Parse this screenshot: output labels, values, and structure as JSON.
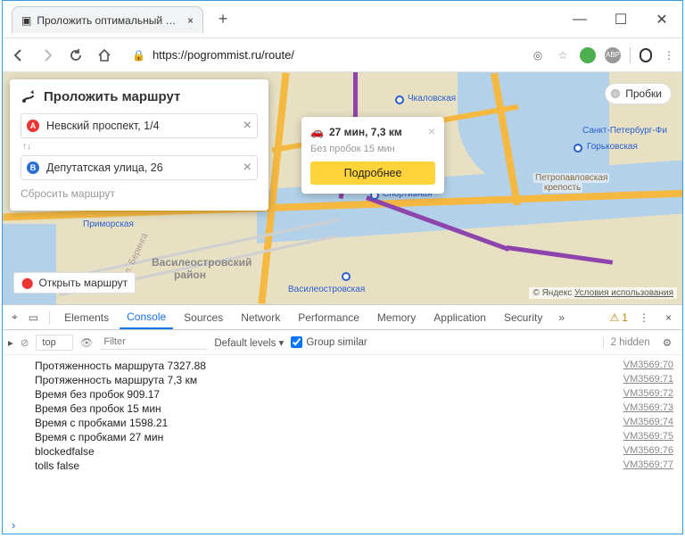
{
  "browser": {
    "tab_title": "Проложить оптимальный марш…",
    "url": "https://pogrommist.ru/route/",
    "url_secure_label": "🔒"
  },
  "route_panel": {
    "title": "Проложить маршрут",
    "from": "Невский проспект, 1/4",
    "to": "Депутатская улица, 26",
    "reset": "Сбросить маршрут"
  },
  "balloon": {
    "summary": "27 мин, 7,3 км",
    "nojam": "Без пробок 15 мин",
    "more": "Подробнее"
  },
  "traffic_label": "Пробки",
  "open_route": "Открыть маршрут",
  "attribution": {
    "prefix": "© Яндекс ",
    "link": "Условия использования"
  },
  "map_labels": {
    "chkalovskaya": "Чкаловская",
    "gorkovskaya": "Горьковская",
    "sportivnaya": "Спортивная",
    "vasileostrovskaya": "Василеостровская",
    "primorskaya": "Приморская",
    "spb_phi": "Санкт-Петербург-Фи",
    "petropavl1": "Петропавловская",
    "petropavl2": "крепость",
    "vasil_rayon1": "Василеостровский",
    "vasil_rayon2": "район",
    "bering": "ул. Беринга"
  },
  "devtools": {
    "tabs": [
      "Elements",
      "Console",
      "Sources",
      "Network",
      "Performance",
      "Memory",
      "Application",
      "Security"
    ],
    "warn_count": "1",
    "context": "top",
    "filter_placeholder": "Filter",
    "levels": "Default levels ▾",
    "group": "Group similar",
    "hidden": "2 hidden",
    "log": [
      {
        "msg": "Протяженность маршрута 7327.88",
        "src": "VM3569:70"
      },
      {
        "msg": "Протяженность маршрута 7,3 км",
        "src": "VM3569:71"
      },
      {
        "msg": "Время без пробок 909.17",
        "src": "VM3569:72"
      },
      {
        "msg": "Время без пробок 15 мин",
        "src": "VM3569:73"
      },
      {
        "msg": "Время с пробками 1598.21",
        "src": "VM3569:74"
      },
      {
        "msg": "Время с пробками 27 мин",
        "src": "VM3569:75"
      },
      {
        "msg": "blockedfalse",
        "src": "VM3569:76"
      },
      {
        "msg": "tolls false",
        "src": "VM3569:77"
      }
    ]
  }
}
